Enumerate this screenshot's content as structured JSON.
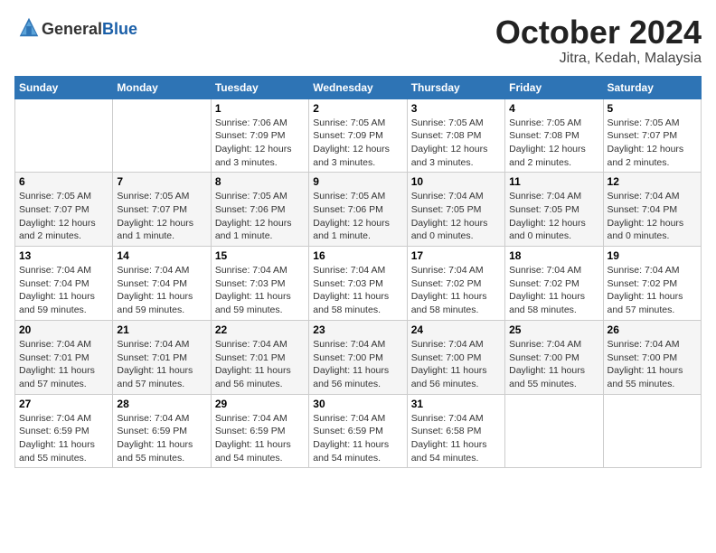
{
  "header": {
    "logo_line1": "General",
    "logo_line2": "Blue",
    "title": "October 2024",
    "subtitle": "Jitra, Kedah, Malaysia"
  },
  "weekdays": [
    "Sunday",
    "Monday",
    "Tuesday",
    "Wednesday",
    "Thursday",
    "Friday",
    "Saturday"
  ],
  "weeks": [
    [
      {
        "day": "",
        "sunrise": "",
        "sunset": "",
        "daylight": ""
      },
      {
        "day": "",
        "sunrise": "",
        "sunset": "",
        "daylight": ""
      },
      {
        "day": "1",
        "sunrise": "Sunrise: 7:06 AM",
        "sunset": "Sunset: 7:09 PM",
        "daylight": "Daylight: 12 hours and 3 minutes."
      },
      {
        "day": "2",
        "sunrise": "Sunrise: 7:05 AM",
        "sunset": "Sunset: 7:09 PM",
        "daylight": "Daylight: 12 hours and 3 minutes."
      },
      {
        "day": "3",
        "sunrise": "Sunrise: 7:05 AM",
        "sunset": "Sunset: 7:08 PM",
        "daylight": "Daylight: 12 hours and 3 minutes."
      },
      {
        "day": "4",
        "sunrise": "Sunrise: 7:05 AM",
        "sunset": "Sunset: 7:08 PM",
        "daylight": "Daylight: 12 hours and 2 minutes."
      },
      {
        "day": "5",
        "sunrise": "Sunrise: 7:05 AM",
        "sunset": "Sunset: 7:07 PM",
        "daylight": "Daylight: 12 hours and 2 minutes."
      }
    ],
    [
      {
        "day": "6",
        "sunrise": "Sunrise: 7:05 AM",
        "sunset": "Sunset: 7:07 PM",
        "daylight": "Daylight: 12 hours and 2 minutes."
      },
      {
        "day": "7",
        "sunrise": "Sunrise: 7:05 AM",
        "sunset": "Sunset: 7:07 PM",
        "daylight": "Daylight: 12 hours and 1 minute."
      },
      {
        "day": "8",
        "sunrise": "Sunrise: 7:05 AM",
        "sunset": "Sunset: 7:06 PM",
        "daylight": "Daylight: 12 hours and 1 minute."
      },
      {
        "day": "9",
        "sunrise": "Sunrise: 7:05 AM",
        "sunset": "Sunset: 7:06 PM",
        "daylight": "Daylight: 12 hours and 1 minute."
      },
      {
        "day": "10",
        "sunrise": "Sunrise: 7:04 AM",
        "sunset": "Sunset: 7:05 PM",
        "daylight": "Daylight: 12 hours and 0 minutes."
      },
      {
        "day": "11",
        "sunrise": "Sunrise: 7:04 AM",
        "sunset": "Sunset: 7:05 PM",
        "daylight": "Daylight: 12 hours and 0 minutes."
      },
      {
        "day": "12",
        "sunrise": "Sunrise: 7:04 AM",
        "sunset": "Sunset: 7:04 PM",
        "daylight": "Daylight: 12 hours and 0 minutes."
      }
    ],
    [
      {
        "day": "13",
        "sunrise": "Sunrise: 7:04 AM",
        "sunset": "Sunset: 7:04 PM",
        "daylight": "Daylight: 11 hours and 59 minutes."
      },
      {
        "day": "14",
        "sunrise": "Sunrise: 7:04 AM",
        "sunset": "Sunset: 7:04 PM",
        "daylight": "Daylight: 11 hours and 59 minutes."
      },
      {
        "day": "15",
        "sunrise": "Sunrise: 7:04 AM",
        "sunset": "Sunset: 7:03 PM",
        "daylight": "Daylight: 11 hours and 59 minutes."
      },
      {
        "day": "16",
        "sunrise": "Sunrise: 7:04 AM",
        "sunset": "Sunset: 7:03 PM",
        "daylight": "Daylight: 11 hours and 58 minutes."
      },
      {
        "day": "17",
        "sunrise": "Sunrise: 7:04 AM",
        "sunset": "Sunset: 7:02 PM",
        "daylight": "Daylight: 11 hours and 58 minutes."
      },
      {
        "day": "18",
        "sunrise": "Sunrise: 7:04 AM",
        "sunset": "Sunset: 7:02 PM",
        "daylight": "Daylight: 11 hours and 58 minutes."
      },
      {
        "day": "19",
        "sunrise": "Sunrise: 7:04 AM",
        "sunset": "Sunset: 7:02 PM",
        "daylight": "Daylight: 11 hours and 57 minutes."
      }
    ],
    [
      {
        "day": "20",
        "sunrise": "Sunrise: 7:04 AM",
        "sunset": "Sunset: 7:01 PM",
        "daylight": "Daylight: 11 hours and 57 minutes."
      },
      {
        "day": "21",
        "sunrise": "Sunrise: 7:04 AM",
        "sunset": "Sunset: 7:01 PM",
        "daylight": "Daylight: 11 hours and 57 minutes."
      },
      {
        "day": "22",
        "sunrise": "Sunrise: 7:04 AM",
        "sunset": "Sunset: 7:01 PM",
        "daylight": "Daylight: 11 hours and 56 minutes."
      },
      {
        "day": "23",
        "sunrise": "Sunrise: 7:04 AM",
        "sunset": "Sunset: 7:00 PM",
        "daylight": "Daylight: 11 hours and 56 minutes."
      },
      {
        "day": "24",
        "sunrise": "Sunrise: 7:04 AM",
        "sunset": "Sunset: 7:00 PM",
        "daylight": "Daylight: 11 hours and 56 minutes."
      },
      {
        "day": "25",
        "sunrise": "Sunrise: 7:04 AM",
        "sunset": "Sunset: 7:00 PM",
        "daylight": "Daylight: 11 hours and 55 minutes."
      },
      {
        "day": "26",
        "sunrise": "Sunrise: 7:04 AM",
        "sunset": "Sunset: 7:00 PM",
        "daylight": "Daylight: 11 hours and 55 minutes."
      }
    ],
    [
      {
        "day": "27",
        "sunrise": "Sunrise: 7:04 AM",
        "sunset": "Sunset: 6:59 PM",
        "daylight": "Daylight: 11 hours and 55 minutes."
      },
      {
        "day": "28",
        "sunrise": "Sunrise: 7:04 AM",
        "sunset": "Sunset: 6:59 PM",
        "daylight": "Daylight: 11 hours and 55 minutes."
      },
      {
        "day": "29",
        "sunrise": "Sunrise: 7:04 AM",
        "sunset": "Sunset: 6:59 PM",
        "daylight": "Daylight: 11 hours and 54 minutes."
      },
      {
        "day": "30",
        "sunrise": "Sunrise: 7:04 AM",
        "sunset": "Sunset: 6:59 PM",
        "daylight": "Daylight: 11 hours and 54 minutes."
      },
      {
        "day": "31",
        "sunrise": "Sunrise: 7:04 AM",
        "sunset": "Sunset: 6:58 PM",
        "daylight": "Daylight: 11 hours and 54 minutes."
      },
      {
        "day": "",
        "sunrise": "",
        "sunset": "",
        "daylight": ""
      },
      {
        "day": "",
        "sunrise": "",
        "sunset": "",
        "daylight": ""
      }
    ]
  ]
}
